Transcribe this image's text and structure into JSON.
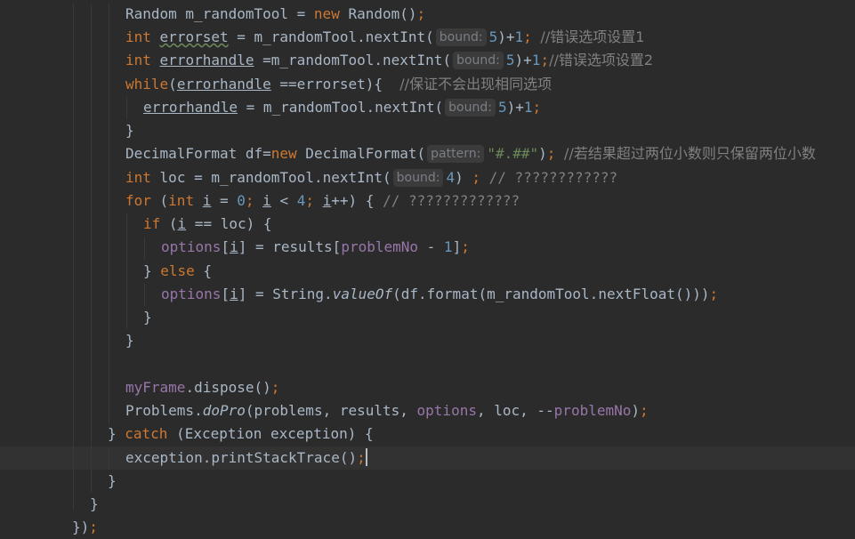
{
  "editor": {
    "kw": {
      "new": "new",
      "int": "int",
      "while": "while",
      "for": "for",
      "if": "if",
      "else": "else",
      "catch": "catch"
    },
    "hints": {
      "bound": "bound:",
      "pattern": "pattern:"
    },
    "nums": {
      "zero": "0",
      "one": "1",
      "four": "4",
      "five": "5"
    },
    "lines": {
      "l1": {
        "a": "Random m_randomTool = ",
        "b": " Random()",
        "c": ";"
      },
      "l2": {
        "var": "errorset",
        "a": " = m_randomTool.nextInt(",
        "b": ")+",
        "c": "; ",
        "comment": "//错误选项设置1"
      },
      "l3": {
        "var": "errorhandle",
        "a": " =m_randomTool.nextInt(",
        "b": ")+",
        "c": ";",
        "comment": "//错误选项设置2"
      },
      "l4": {
        "a": "(",
        "v1": "errorhandle",
        "b": " ==errorset){  ",
        "comment": "//保证不会出现相同选项"
      },
      "l5": {
        "var": "errorhandle",
        "a": " = m_randomTool.nextInt(",
        "b": ")+",
        "c": ";"
      },
      "l6": {
        "a": "}"
      },
      "l7": {
        "a": "DecimalFormat df=",
        "b": " DecimalFormat(",
        "str": "\"#.##\"",
        "c": ")",
        "d": "; ",
        "comment": "//若结果超过两位小数则只保留两位小数"
      },
      "l8": {
        "var": "loc",
        "a": " = m_randomTool.nextInt(",
        "b": ") ",
        "c": "; ",
        "comment": "// ????????????"
      },
      "l9": {
        "a": " (",
        "i1": "i",
        "b": " = ",
        "c": "; ",
        "i2": "i",
        "d": " < ",
        "e": "; ",
        "i3": "i",
        "f": "++) { ",
        "comment": "// ?????????????"
      },
      "l10": {
        "a": " (",
        "i": "i",
        "b": " == loc) {"
      },
      "l11": {
        "arr": "options",
        "a": "[",
        "i": "i",
        "b": "] = results[",
        "fld": "problemNo",
        "c": " - ",
        "d": "]",
        "e": ";"
      },
      "l12": {
        "a": "} ",
        "b": " {"
      },
      "l13": {
        "arr": "options",
        "a": "[",
        "i": "i",
        "b": "] = String.",
        "m": "valueOf",
        "c": "(df.format(m_randomTool.nextFloat()))",
        "d": ";"
      },
      "l14": {
        "a": "}"
      },
      "l15": {
        "a": "}"
      },
      "l16": {
        "fld": "myFrame",
        "a": ".dispose()",
        "b": ";"
      },
      "l17": {
        "a": "Problems.",
        "m": "doPro",
        "b": "(problems, results, ",
        "fld": "options",
        "c": ", loc, --",
        "fld2": "problemNo",
        "d": ")",
        "e": ";"
      },
      "l18": {
        "a": "} ",
        "b": " (Exception exception) {"
      },
      "l19": {
        "a": "exception.printStackTrace()",
        "b": ";"
      },
      "l20": {
        "a": "}"
      },
      "l21": {
        "a": "}"
      },
      "l22": {
        "a": "})",
        "b": ";"
      }
    }
  }
}
